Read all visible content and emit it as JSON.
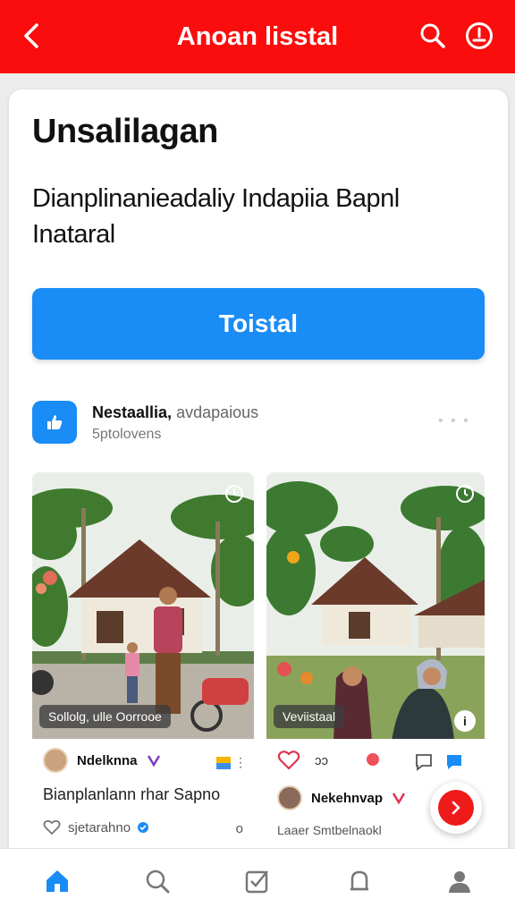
{
  "topbar": {
    "title": "Anoan lisstal"
  },
  "content": {
    "heading": "Unsalilagan",
    "subtitle": "Dianplinanieadaliy Indapiia Bapnl Inataral",
    "cta_label": "Toistal"
  },
  "feed_header": {
    "name": "Nestaallia,",
    "handle": "avdapaious",
    "sub": "5ptolovens"
  },
  "posts": [
    {
      "overlay": "Sollolg, ulle Oorrooe",
      "author": "Ndelknna",
      "text": "Bianplanlann rhar Sapno",
      "meta": "sjetarahno",
      "count": "o"
    },
    {
      "overlay": "Veviistaal",
      "like_count": "ɔɔ",
      "author": "Nekehnvap",
      "meta": "Laaer Smtbelnaokl"
    }
  ],
  "colors": {
    "brand": "#fb0d0d",
    "accent": "#1a8cf5"
  }
}
